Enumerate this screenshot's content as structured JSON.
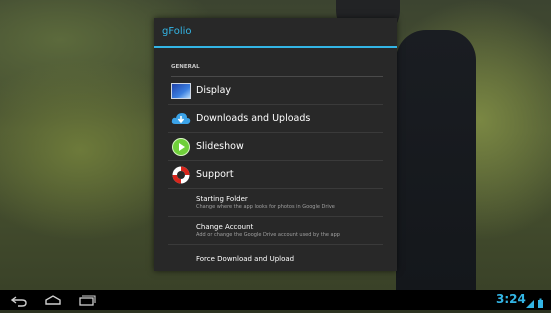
{
  "dialog": {
    "title": "gFolio",
    "section_header": "GENERAL",
    "items": [
      {
        "label": "Display",
        "icon": "display-icon"
      },
      {
        "label": "Downloads and Uploads",
        "icon": "cloud-download-icon"
      },
      {
        "label": "Slideshow",
        "icon": "play-icon"
      },
      {
        "label": "Support",
        "icon": "lifebuoy-icon"
      }
    ],
    "text_items": [
      {
        "title": "Starting Folder",
        "summary": "Change where the app looks for photos in Google Drive"
      },
      {
        "title": "Change Account",
        "summary": "Add or change the Google Drive account used by the app"
      },
      {
        "title": "Force Download and Upload",
        "summary": ""
      }
    ]
  },
  "navbar": {
    "buttons": [
      "back-icon",
      "home-icon",
      "recent-apps-icon"
    ],
    "clock": "3:24"
  },
  "colors": {
    "accent": "#33b5e5",
    "dialog_bg": "#282828",
    "navbar_bg": "#000000"
  }
}
